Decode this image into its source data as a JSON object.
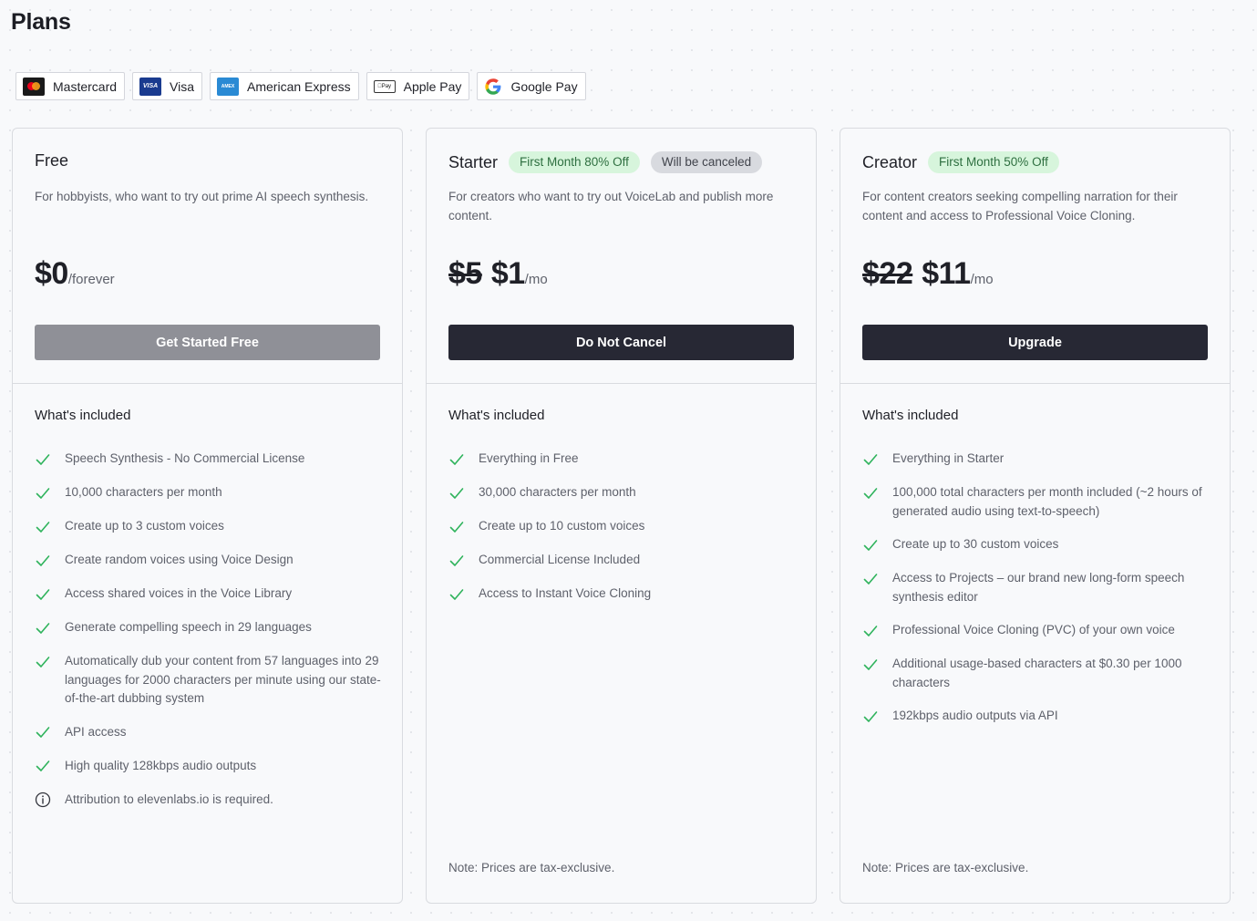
{
  "page": {
    "title": "Plans"
  },
  "payment_methods": [
    {
      "label": "Mastercard",
      "icon": "mastercard-icon"
    },
    {
      "label": "Visa",
      "icon": "visa-icon",
      "logo_text": "VISA"
    },
    {
      "label": "American Express",
      "icon": "amex-icon",
      "logo_text": "AMEX"
    },
    {
      "label": "Apple Pay",
      "icon": "apple-pay-icon",
      "logo_text": "Pay"
    },
    {
      "label": "Google Pay",
      "icon": "google-icon"
    }
  ],
  "plans": [
    {
      "name": "Free",
      "badges": [],
      "description": "For hobbyists, who want to try out prime AI speech synthesis.",
      "price_old": "",
      "price_new": "$0",
      "price_unit": "/forever",
      "cta": "Get Started Free",
      "included_title": "What's included",
      "features": [
        {
          "text": "Speech Synthesis - No Commercial License",
          "icon": "check-icon"
        },
        {
          "text": "10,000 characters per month",
          "icon": "check-icon"
        },
        {
          "text": "Create up to 3 custom voices",
          "icon": "check-icon"
        },
        {
          "text": "Create random voices using Voice Design",
          "icon": "check-icon"
        },
        {
          "text": "Access shared voices in the Voice Library",
          "icon": "check-icon"
        },
        {
          "text": "Generate compelling speech in 29 languages",
          "icon": "check-icon"
        },
        {
          "text": "Automatically dub your content from 57 languages into 29 languages for 2000 characters per minute using our state-of-the-art dubbing system",
          "icon": "check-icon"
        },
        {
          "text": "API access",
          "icon": "check-icon"
        },
        {
          "text": "High quality 128kbps audio outputs",
          "icon": "check-icon"
        },
        {
          "text": "Attribution to elevenlabs.io is required.",
          "icon": "info-icon"
        }
      ],
      "note": ""
    },
    {
      "name": "Starter",
      "badges": [
        {
          "text": "First Month 80% Off",
          "style": "green"
        },
        {
          "text": "Will be canceled",
          "style": "gray"
        }
      ],
      "description": "For creators who want to try out VoiceLab and publish more content.",
      "price_old": "$5",
      "price_new": "$1",
      "price_unit": "/mo",
      "cta": "Do Not Cancel",
      "included_title": "What's included",
      "features": [
        {
          "text": "Everything in Free",
          "icon": "check-icon"
        },
        {
          "text": "30,000 characters per month",
          "icon": "check-icon"
        },
        {
          "text": "Create up to 10 custom voices",
          "icon": "check-icon"
        },
        {
          "text": "Commercial License Included",
          "icon": "check-icon"
        },
        {
          "text": "Access to Instant Voice Cloning",
          "icon": "check-icon"
        }
      ],
      "note": "Note: Prices are tax-exclusive."
    },
    {
      "name": "Creator",
      "badges": [
        {
          "text": "First Month 50% Off",
          "style": "green"
        }
      ],
      "description": "For content creators seeking compelling narration for their content and access to Professional Voice Cloning.",
      "price_old": "$22",
      "price_new": "$11",
      "price_unit": "/mo",
      "cta": "Upgrade",
      "included_title": "What's included",
      "features": [
        {
          "text": "Everything in Starter",
          "icon": "check-icon"
        },
        {
          "text": "100,000 total characters per month included (~2 hours of generated audio using text-to-speech)",
          "icon": "check-icon"
        },
        {
          "text": "Create up to 30 custom voices",
          "icon": "check-icon"
        },
        {
          "text": "Access to Projects – our brand new long-form speech synthesis editor",
          "icon": "check-icon"
        },
        {
          "text": "Professional Voice Cloning (PVC) of your own voice",
          "icon": "check-icon"
        },
        {
          "text": "Additional usage-based characters at $0.30 per 1000 characters",
          "icon": "check-icon"
        },
        {
          "text": "192kbps audio outputs via API",
          "icon": "check-icon"
        }
      ],
      "note": "Note: Prices are tax-exclusive."
    }
  ],
  "colors": {
    "check": "#2fb35c",
    "button_dark": "#272834",
    "button_disabled": "#8f9097",
    "badge_green_bg": "#d7f5dc",
    "badge_gray_bg": "#d8dadf"
  }
}
